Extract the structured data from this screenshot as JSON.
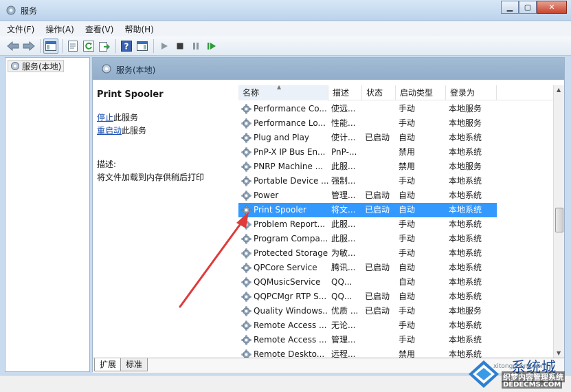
{
  "window": {
    "title": "服务"
  },
  "menu": [
    "文件(F)",
    "操作(A)",
    "查看(V)",
    "帮助(H)"
  ],
  "tree": {
    "item": "服务(本地)"
  },
  "panel": {
    "header": "服务(本地)"
  },
  "detail": {
    "name": "Print Spooler",
    "stop_link": "停止",
    "stop_suffix": "此服务",
    "restart_link": "重启动",
    "restart_suffix": "此服务",
    "desc_label": "描述:",
    "desc_text": "将文件加载到内存供稍后打印"
  },
  "columns": [
    "名称",
    "描述",
    "状态",
    "启动类型",
    "登录为"
  ],
  "services": [
    {
      "name": "Performance Co...",
      "desc": "使远...",
      "status": "",
      "startup": "手动",
      "logon": "本地服务"
    },
    {
      "name": "Performance Lo...",
      "desc": "性能...",
      "status": "",
      "startup": "手动",
      "logon": "本地服务"
    },
    {
      "name": "Plug and Play",
      "desc": "使计...",
      "status": "已启动",
      "startup": "自动",
      "logon": "本地系统"
    },
    {
      "name": "PnP-X IP Bus En...",
      "desc": "PnP-...",
      "status": "",
      "startup": "禁用",
      "logon": "本地系统"
    },
    {
      "name": "PNRP Machine ...",
      "desc": "此服...",
      "status": "",
      "startup": "禁用",
      "logon": "本地服务"
    },
    {
      "name": "Portable Device ...",
      "desc": "强制...",
      "status": "",
      "startup": "手动",
      "logon": "本地系统"
    },
    {
      "name": "Power",
      "desc": "管理...",
      "status": "已启动",
      "startup": "自动",
      "logon": "本地系统"
    },
    {
      "name": "Print Spooler",
      "desc": "将文...",
      "status": "已启动",
      "startup": "自动",
      "logon": "本地系统",
      "selected": true
    },
    {
      "name": "Problem Report...",
      "desc": "此服...",
      "status": "",
      "startup": "手动",
      "logon": "本地系统"
    },
    {
      "name": "Program Compa...",
      "desc": "此服...",
      "status": "",
      "startup": "手动",
      "logon": "本地系统"
    },
    {
      "name": "Protected Storage",
      "desc": "为敏...",
      "status": "",
      "startup": "手动",
      "logon": "本地系统"
    },
    {
      "name": "QPCore Service",
      "desc": "腾讯...",
      "status": "已启动",
      "startup": "自动",
      "logon": "本地系统"
    },
    {
      "name": "QQMusicService",
      "desc": "QQ...",
      "status": "",
      "startup": "自动",
      "logon": "本地系统"
    },
    {
      "name": "QQPCMgr RTP S...",
      "desc": "QQ...",
      "status": "已启动",
      "startup": "自动",
      "logon": "本地系统"
    },
    {
      "name": "Quality Windows...",
      "desc": "优质 ...",
      "status": "已启动",
      "startup": "手动",
      "logon": "本地服务"
    },
    {
      "name": "Remote Access ...",
      "desc": "无论...",
      "status": "",
      "startup": "手动",
      "logon": "本地系统"
    },
    {
      "name": "Remote Access ...",
      "desc": "管理...",
      "status": "",
      "startup": "手动",
      "logon": "本地系统"
    },
    {
      "name": "Remote Deskto...",
      "desc": "远程...",
      "status": "",
      "startup": "禁用",
      "logon": "本地系统"
    }
  ],
  "tabs": [
    "扩展",
    "标准"
  ],
  "watermark": {
    "title": "系统城",
    "sub": "织梦内容管理系统",
    "url": "DEDECMS.COM",
    "site": "xitongcheng.com"
  },
  "colors": {
    "selection": "#3399ff",
    "link": "#1b4fb0",
    "annotation_arrow": "#e03a3a"
  }
}
